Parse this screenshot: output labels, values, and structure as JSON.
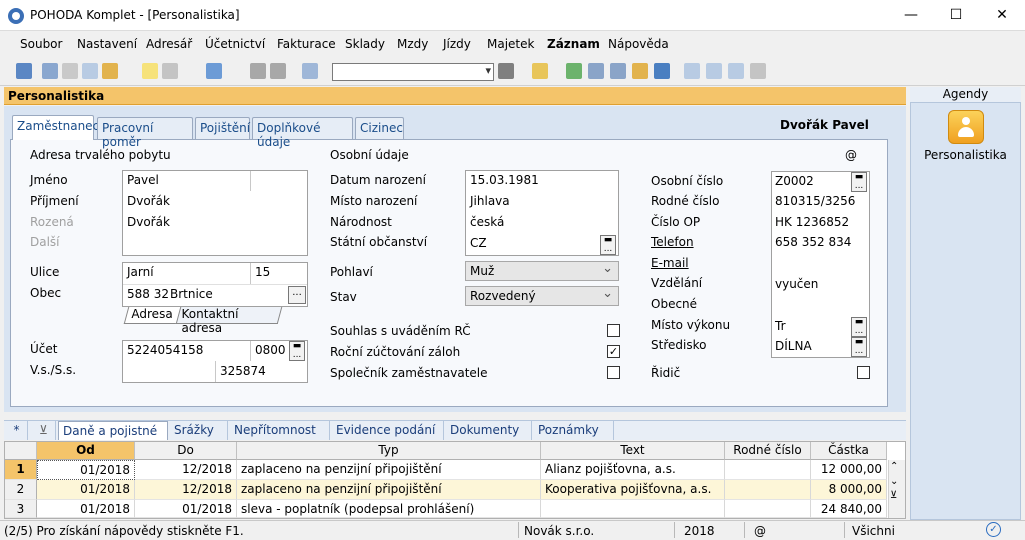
{
  "window": {
    "title": "POHODA Komplet - [Personalistika]",
    "minimize": "—",
    "maximize": "☐",
    "close": "✕"
  },
  "menu": [
    "Soubor",
    "Nastavení",
    "Adresář",
    "Účetnictví",
    "Fakturace",
    "Sklady",
    "Mzdy",
    "Jízdy",
    "Majetek",
    "Záznam",
    "Nápověda"
  ],
  "agenda_title": "Personalistika",
  "agendy": {
    "title": "Agendy",
    "item": "Personalistika"
  },
  "tabs": [
    "Zaměstnanec",
    "Pracovní poměr",
    "Pojištění",
    "Doplňkové údaje",
    "Cizinec"
  ],
  "employee_name": "Dvořák Pavel",
  "address": {
    "section_title": "Adresa trvalého pobytu",
    "labels": {
      "first": "Jméno",
      "last": "Příjmení",
      "maiden": "Rozená",
      "other": "Další",
      "street": "Ulice",
      "city": "Obec"
    },
    "first": "Pavel",
    "last": "Dvořák",
    "maiden": "Dvořák",
    "street": "Jarní",
    "number": "15",
    "zip": "588 32",
    "city": "Brtnice",
    "subtabs": [
      "Adresa",
      "Kontaktní adresa"
    ]
  },
  "bank": {
    "account_label": "Účet",
    "vs_label": "V.s./S.s.",
    "account": "5224054158",
    "bank_code": "0800",
    "ss": "325874"
  },
  "personal": {
    "section_title": "Osobní údaje",
    "at_icon": "@",
    "labels": {
      "birth_date": "Datum narození",
      "birth_place": "Místo narození",
      "nationality": "Národnost",
      "citizenship": "Státní občanství",
      "gender": "Pohlaví",
      "status": "Stav"
    },
    "birth_date": "15.03.1981",
    "birth_place": "Jihlava",
    "nationality": "česká",
    "citizenship": "CZ",
    "gender": "Muž",
    "status": "Rozvedený"
  },
  "checks": {
    "rc_consent": {
      "label": "Souhlas s uváděním RČ",
      "checked": false
    },
    "annual": {
      "label": "Roční zúčtování záloh",
      "checked": true
    },
    "partner": {
      "label": "Společník zaměstnavatele",
      "checked": false
    },
    "driver": {
      "label": "Řidič",
      "checked": false
    }
  },
  "ids": {
    "labels": {
      "personal_no": "Osobní číslo",
      "birth_no": "Rodné číslo",
      "op_no": "Číslo OP",
      "phone": "Telefon",
      "email": "E-mail",
      "education": "Vzdělání",
      "general": "Obecné",
      "workplace": "Místo výkonu",
      "center": "Středisko"
    },
    "personal_no": "Z0002",
    "birth_no": "810315/3256",
    "op_no": "HK 1236852",
    "phone": "658 352 834",
    "education": "vyučen",
    "workplace": "Tr",
    "center": "DÍLNA"
  },
  "bottom_tabs": [
    "Daně a pojistné",
    "Srážky",
    "Nepřítomnost",
    "Evidence podání",
    "Dokumenty",
    "Poznámky"
  ],
  "grid": {
    "columns": [
      "Od",
      "Do",
      "Typ",
      "Text",
      "Rodné číslo",
      "Částka"
    ],
    "rows": [
      {
        "n": "1",
        "od": "01/2018",
        "do": "12/2018",
        "typ": "zaplaceno na penzijní připojištění",
        "text": "Alianz pojišťovna, a.s.",
        "rc": "",
        "castka": "12 000,00"
      },
      {
        "n": "2",
        "od": "01/2018",
        "do": "12/2018",
        "typ": "zaplaceno na penzijní připojištění",
        "text": "Kooperativa pojišťovna, a.s.",
        "rc": "",
        "castka": "8 000,00"
      },
      {
        "n": "3",
        "od": "01/2018",
        "do": "01/2018",
        "typ": "sleva - poplatník (podepsal prohlášení)",
        "text": "",
        "rc": "",
        "castka": "24 840,00"
      }
    ]
  },
  "status": {
    "help": "(2/5) Pro získání nápovědy stiskněte F1.",
    "company": "Novák s.r.o.",
    "year": "2018",
    "at": "@",
    "filter": "Všichni"
  }
}
